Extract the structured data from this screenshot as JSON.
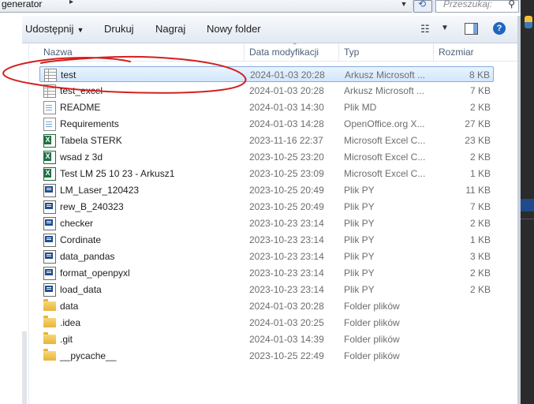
{
  "address": {
    "path_tail": "generator",
    "search_placeholder": "Przeszukaj:"
  },
  "toolbar": {
    "share": "Udostępnij",
    "print": "Drukuj",
    "burn": "Nagraj",
    "new_folder": "Nowy folder"
  },
  "columns": {
    "name": "Nazwa",
    "date": "Data modyfikacji",
    "type": "Typ",
    "size": "Rozmiar"
  },
  "files": [
    {
      "name": "test",
      "date": "2024-01-03 20:28",
      "type": "Arkusz Microsoft ...",
      "size": "8 KB",
      "icon": "spreadsheet-icon"
    },
    {
      "name": "test_excel",
      "date": "2024-01-03 20:28",
      "type": "Arkusz Microsoft ...",
      "size": "7 KB",
      "icon": "spreadsheet-icon"
    },
    {
      "name": "README",
      "date": "2024-01-03 14:30",
      "type": "Plik MD",
      "size": "2 KB",
      "icon": "document-icon"
    },
    {
      "name": "Requirements",
      "date": "2024-01-03 14:28",
      "type": "OpenOffice.org X...",
      "size": "27 KB",
      "icon": "document-icon"
    },
    {
      "name": "Tabela STERK",
      "date": "2023-11-16 22:37",
      "type": "Microsoft Excel C...",
      "size": "23 KB",
      "icon": "excel-icon"
    },
    {
      "name": "wsad z 3d",
      "date": "2023-10-25 23:20",
      "type": "Microsoft Excel C...",
      "size": "2 KB",
      "icon": "excel-icon"
    },
    {
      "name": "Test LM 25 10 23 - Arkusz1",
      "date": "2023-10-25 23:09",
      "type": "Microsoft Excel C...",
      "size": "1 KB",
      "icon": "excel-icon"
    },
    {
      "name": "LM_Laser_120423",
      "date": "2023-10-25 20:49",
      "type": "Plik PY",
      "size": "11 KB",
      "icon": "python-file-icon"
    },
    {
      "name": "rew_B_240323",
      "date": "2023-10-25 20:49",
      "type": "Plik PY",
      "size": "7 KB",
      "icon": "python-file-icon"
    },
    {
      "name": "checker",
      "date": "2023-10-23 23:14",
      "type": "Plik PY",
      "size": "2 KB",
      "icon": "python-file-icon"
    },
    {
      "name": "Cordinate",
      "date": "2023-10-23 23:14",
      "type": "Plik PY",
      "size": "1 KB",
      "icon": "python-file-icon"
    },
    {
      "name": "data_pandas",
      "date": "2023-10-23 23:14",
      "type": "Plik PY",
      "size": "3 KB",
      "icon": "python-file-icon"
    },
    {
      "name": "format_openpyxl",
      "date": "2023-10-23 23:14",
      "type": "Plik PY",
      "size": "2 KB",
      "icon": "python-file-icon"
    },
    {
      "name": "load_data",
      "date": "2023-10-23 23:14",
      "type": "Plik PY",
      "size": "2 KB",
      "icon": "python-file-icon"
    },
    {
      "name": "data",
      "date": "2024-01-03 20:28",
      "type": "Folder plików",
      "size": "",
      "icon": "folder-icon"
    },
    {
      "name": ".idea",
      "date": "2024-01-03 20:25",
      "type": "Folder plików",
      "size": "",
      "icon": "folder-icon"
    },
    {
      "name": ".git",
      "date": "2024-01-03 14:39",
      "type": "Folder plików",
      "size": "",
      "icon": "folder-icon"
    },
    {
      "name": "__pycache__",
      "date": "2023-10-25 22:49",
      "type": "Folder plików",
      "size": "",
      "icon": "folder-icon"
    }
  ],
  "selected_file": "test",
  "colors": {
    "selection": "#d2e6fc",
    "annotation": "#d42020"
  }
}
